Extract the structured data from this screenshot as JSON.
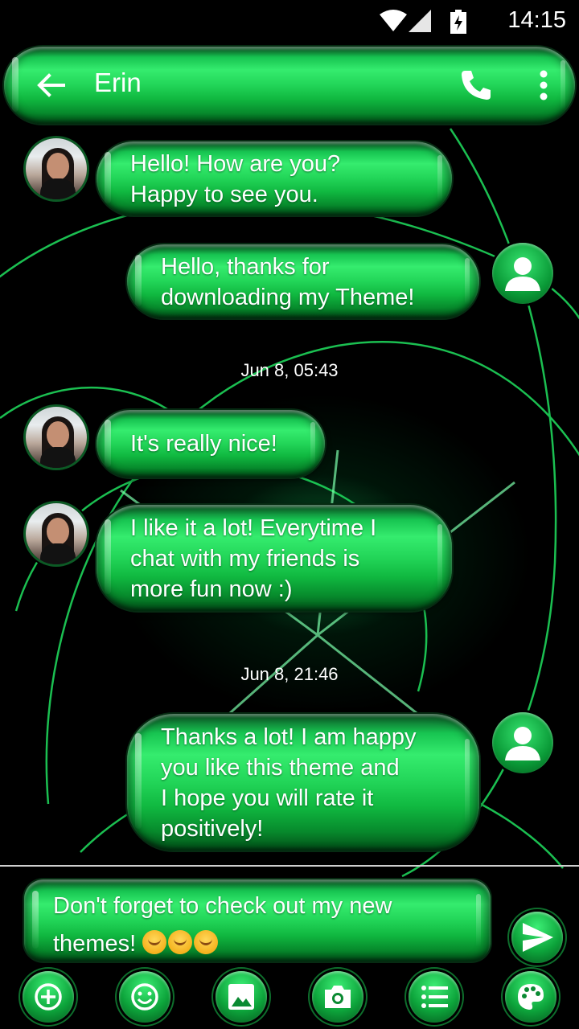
{
  "status": {
    "time": "14:15"
  },
  "toolbar": {
    "title": "Erin"
  },
  "messages": [
    {
      "direction": "incoming",
      "text": "Hello! How are you?\nHappy to see you."
    },
    {
      "direction": "outgoing",
      "text": "Hello, thanks for\ndownloading my Theme!"
    },
    {
      "type": "timestamp",
      "text": "Jun 8, 05:43"
    },
    {
      "direction": "incoming",
      "text": "It's really nice!"
    },
    {
      "direction": "incoming",
      "text": "I like it a lot! Everytime I\nchat with my friends is\nmore fun now :)"
    },
    {
      "type": "timestamp",
      "text": "Jun 8, 21:46"
    },
    {
      "direction": "outgoing",
      "text": "Thanks a lot! I am happy\nyou like this theme and\nI hope you will rate it\npositively!"
    }
  ],
  "composer": {
    "text": "Don't forget to check out my new themes!",
    "emojis": [
      "heart-eyes",
      "kissing",
      "kissing-closed-eyes"
    ]
  },
  "bottom_bar": [
    "add",
    "emoji",
    "gallery",
    "camera",
    "template-list",
    "palette"
  ],
  "colors": {
    "accent": "#22d558",
    "background": "#000000"
  }
}
